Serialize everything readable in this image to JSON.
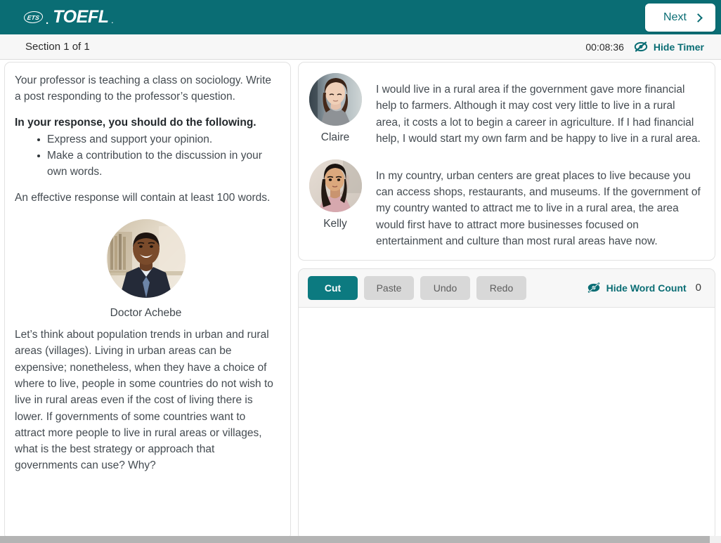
{
  "header": {
    "brand_mark": "ETS",
    "brand_name": "TOEFL",
    "brand_superscript": ".",
    "next_label": "Next",
    "next_icon": "chevron-right-icon",
    "bg_color": "#0a6d74"
  },
  "subheader": {
    "section_label": "Section 1 of 1",
    "timer_value": "00:08:36",
    "hide_timer_label": "Hide Timer",
    "hide_timer_icon": "eye-slash-icon"
  },
  "prompt": {
    "intro": "Your professor is teaching a class on sociology. Write a post responding to the professor’s question.",
    "requirements_heading": "In your response, you should do the following.",
    "requirements": [
      "Express and support your opinion.",
      "Make a contribution to the discussion in your own words."
    ],
    "length_note": "An effective response will contain at least 100 words.",
    "professor_name": "Doctor Achebe",
    "professor_avatar": "professor-portrait",
    "question": "Let’s think about population trends in urban and rural areas (villages). Living in urban areas can be expensive; nonetheless, when they have a choice of where to live, people in some countries do not wish to live in rural areas even if the cost of living there is lower. If governments of some countries want to attract more people to live in rural areas or villages, what is the best strategy or approach that governments can use? Why?"
  },
  "discussion": {
    "posts": [
      {
        "author": "Claire",
        "avatar": "claire-portrait",
        "text": "I would live in a rural area if the government gave more financial help to farmers. Although it may cost very little to live in a rural area, it costs a lot to begin a career in agriculture. If I had financial help, I would start my own farm and be happy to live in a rural area."
      },
      {
        "author": "Kelly",
        "avatar": "kelly-portrait",
        "text": "In my country, urban centers are great places to live because you can access shops, restaurants, and museums. If the government of my country wanted to attract me to live in a rural area, the area would first have to attract more businesses focused on entertainment and culture than most rural areas have now."
      }
    ]
  },
  "editor": {
    "toolbar": {
      "cut_label": "Cut",
      "paste_label": "Paste",
      "undo_label": "Undo",
      "redo_label": "Redo"
    },
    "hide_word_count_label": "Hide Word Count",
    "hide_word_count_icon": "eye-slash-icon",
    "word_count": "0",
    "response_value": "",
    "response_placeholder": ""
  },
  "colors": {
    "brand_teal": "#0a6d74",
    "button_teal": "#0c7a80",
    "disabled_gray": "#d8d8d8",
    "panel_border": "#e2e2e2"
  }
}
